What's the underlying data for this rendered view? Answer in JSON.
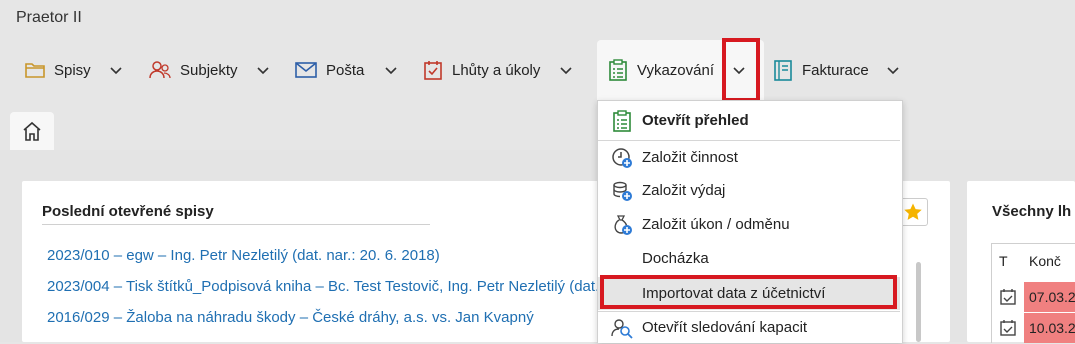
{
  "app": {
    "title": "Praetor II"
  },
  "nav": {
    "items": [
      {
        "label": "Spisy",
        "icon": "folder-icon"
      },
      {
        "label": "Subjekty",
        "icon": "people-icon"
      },
      {
        "label": "Pošta",
        "icon": "mail-icon"
      },
      {
        "label": "Lhůty a úkoly",
        "icon": "calendar-check-icon"
      },
      {
        "label": "Vykazování",
        "icon": "clipboard-list-icon"
      },
      {
        "label": "Fakturace",
        "icon": "invoice-icon"
      }
    ]
  },
  "dropdown": {
    "items": [
      {
        "label": "Otevřít přehled",
        "icon": "clipboard-list-icon",
        "bold": true
      },
      {
        "label": "Založit činnost",
        "icon": "clock-plus-icon"
      },
      {
        "label": "Založit výdaj",
        "icon": "coins-plus-icon"
      },
      {
        "label": "Založit úkon / odměnu",
        "icon": "moneybag-plus-icon"
      },
      {
        "label": "Docházka",
        "icon": ""
      },
      {
        "label": "Importovat data z účetnictví",
        "icon": "",
        "highlighted": true
      },
      {
        "label": "Otevřít sledování kapacit",
        "icon": "people-search-icon"
      }
    ]
  },
  "recent": {
    "title": "Poslední otevřené spisy",
    "items": [
      "2023/010 – egw – Ing. Petr Nezletilý (dat. nar.: 20. 6. 2018)",
      "2023/004 – Tisk štítků_Podpisová kniha – Bc. Test Testovič, Ing. Petr Nezletilý (dat. n",
      "2016/029 – Žaloba na náhradu škody  – České dráhy, a.s. vs. Jan Kvapný"
    ]
  },
  "deadlines": {
    "title": "Všechny lh",
    "columns": [
      "T",
      "Konč"
    ],
    "rows": [
      "07.03.20",
      "10.03.20"
    ]
  },
  "colors": {
    "accent_red": "#d71920",
    "link": "#1f6fb2",
    "overdue": "#f08080"
  }
}
